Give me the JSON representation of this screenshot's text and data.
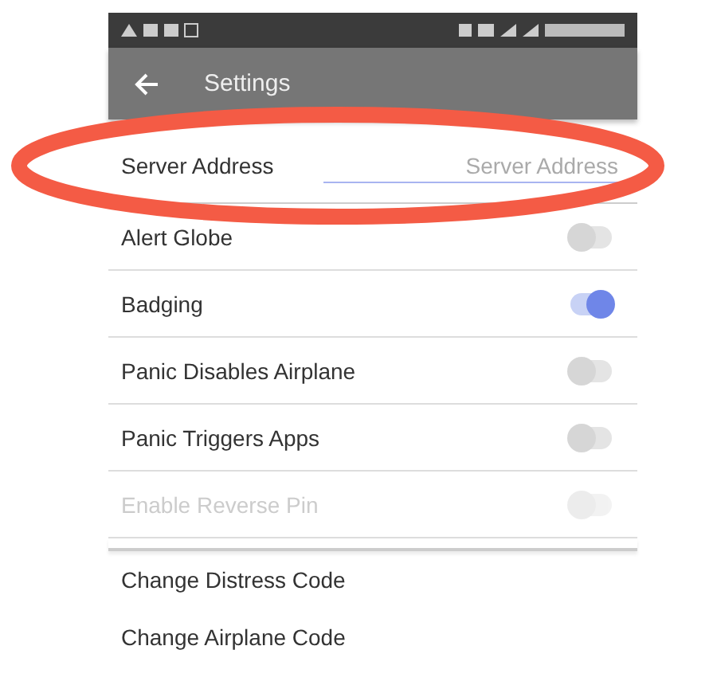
{
  "app_bar": {
    "title": "Settings"
  },
  "server_address": {
    "label": "Server Address",
    "placeholder": "Server Address"
  },
  "settings": [
    {
      "label": "Alert Globe",
      "on": false,
      "disabled": false
    },
    {
      "label": "Badging",
      "on": true,
      "disabled": false
    },
    {
      "label": "Panic Disables Airplane",
      "on": false,
      "disabled": false
    },
    {
      "label": "Panic Triggers Apps",
      "on": false,
      "disabled": false
    },
    {
      "label": "Enable Reverse Pin",
      "on": false,
      "disabled": true
    }
  ],
  "actions": [
    "Change Distress Code",
    "Change Airplane Code"
  ],
  "annotation": {
    "kind": "ellipse",
    "color": "#f45b45"
  }
}
